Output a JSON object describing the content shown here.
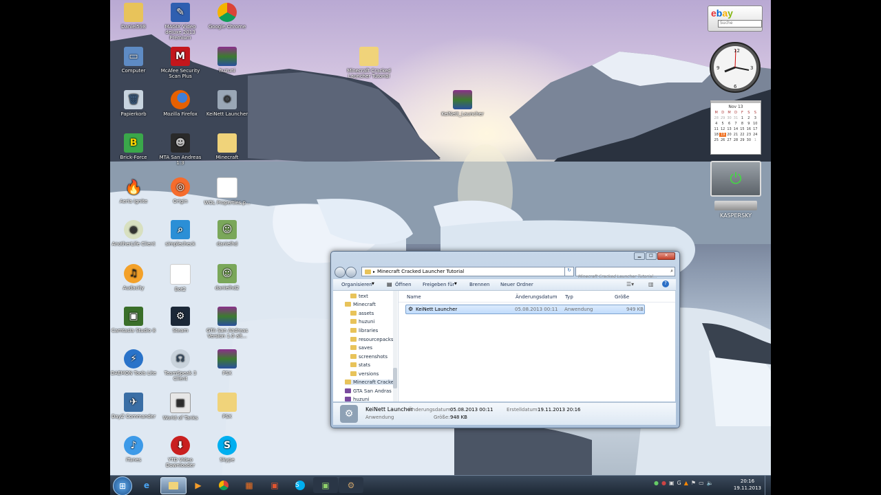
{
  "desktop_icons": [
    {
      "label": "Daniel598",
      "x": 0
    },
    {
      "label": "MAGIX Video deluxe 2013 Premium"
    },
    {
      "label": "Google Chrome"
    },
    {
      "label": "Computer"
    },
    {
      "label": "McAfee Security Scan Plus"
    },
    {
      "label": "huzuni"
    },
    {
      "label": "Papierkorb"
    },
    {
      "label": "Mozilla Firefox"
    },
    {
      "label": "KeiNett Launcher"
    },
    {
      "label": "Brick-Force"
    },
    {
      "label": "MTA San Andreas 1.3"
    },
    {
      "label": "Minecraft"
    },
    {
      "label": "Aeria Ignite"
    },
    {
      "label": "Origin"
    },
    {
      "label": "WOL Properties.p..."
    },
    {
      "label": "AnotherLife Client"
    },
    {
      "label": "simplecheck"
    },
    {
      "label": "danielhd"
    },
    {
      "label": "Audacity"
    },
    {
      "label": "Bot2"
    },
    {
      "label": "danielhd2"
    },
    {
      "label": "Camtasia Studio 8"
    },
    {
      "label": "Steam"
    },
    {
      "label": "GTA San Andreas Version 1.0 alt..."
    },
    {
      "label": "DAEMON Tools Lite"
    },
    {
      "label": "TeamSpeak 3 Client"
    },
    {
      "label": "PSX"
    },
    {
      "label": "DayZ Commander"
    },
    {
      "label": "World of Tanks"
    },
    {
      "label": "PSX"
    },
    {
      "label": "iTunes"
    },
    {
      "label": "YTD Video Downloader"
    },
    {
      "label": "Skype"
    }
  ],
  "floating_icons": {
    "folder_tutorial": "Minecraft Cracked Launcher Tutorial",
    "keinett": "KeiNett_Launcher"
  },
  "gadgets": {
    "ebay_search_placeholder": "Suche",
    "calendar_month": "Nov 13",
    "calendar_days": [
      "M",
      "D",
      "M",
      "D",
      "F",
      "S",
      "S"
    ],
    "calendar_rows": [
      [
        "28",
        "29",
        "30",
        "31",
        "1",
        "2",
        "3"
      ],
      [
        "4",
        "5",
        "6",
        "7",
        "8",
        "9",
        "10"
      ],
      [
        "11",
        "12",
        "13",
        "14",
        "15",
        "16",
        "17"
      ],
      [
        "18",
        "19",
        "20",
        "21",
        "22",
        "23",
        "24"
      ],
      [
        "25",
        "26",
        "27",
        "28",
        "29",
        "30",
        "1"
      ]
    ],
    "kaspersky": "KASPERSKY"
  },
  "window": {
    "address": "Minecraft Cracked Launcher Tutorial",
    "search_placeholder": "Minecraft Cracked Launcher Tutorial...",
    "toolbar": {
      "organize": "Organisieren",
      "open": "Öffnen",
      "share": "Freigeben für",
      "burn": "Brennen",
      "new_folder": "Neuer Ordner"
    },
    "tree": [
      "text",
      "Minecraft",
      "assets",
      "huzuni",
      "libraries",
      "resourcepacks",
      "saves",
      "screenshots",
      "stats",
      "versions",
      "Minecraft Cracke",
      "GTA San Andras",
      "huzuni"
    ],
    "columns": {
      "name": "Name",
      "date": "Änderungsdatum",
      "type": "Typ",
      "size": "Größe"
    },
    "file": {
      "name": "KeiNett Launcher",
      "date": "05.08.2013 00:11",
      "type": "Anwendung",
      "size": "949 KB"
    },
    "details": {
      "name": "KeiNett Launcher",
      "type": "Anwendung",
      "mod_label": "Änderungsdatum:",
      "mod_value": "05.08.2013 00:11",
      "size_label": "Größe:",
      "size_value": "948 KB",
      "created_label": "Erstelldatum:",
      "created_value": "19.11.2013 20:16"
    }
  },
  "taskbar": {
    "time": "20:16",
    "date": "19.11.2013"
  }
}
